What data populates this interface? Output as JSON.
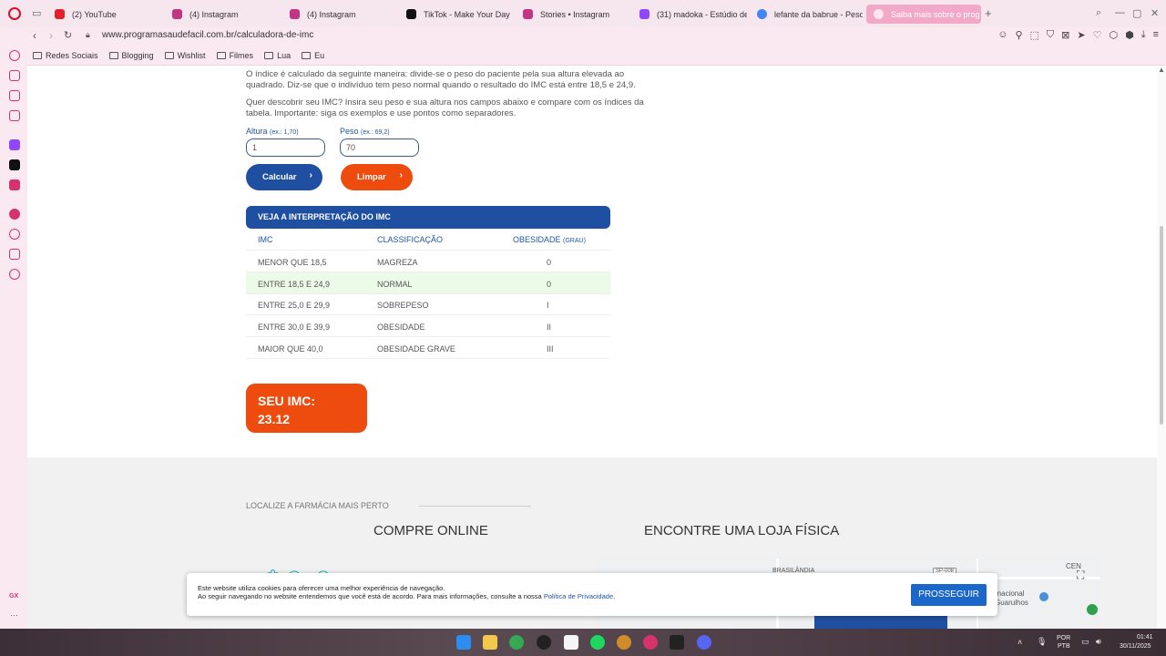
{
  "browser": {
    "tabs": [
      {
        "label": "(2) YouTube",
        "icon": "youtube-icon",
        "color": "#e0202b"
      },
      {
        "label": "(4) Instagram",
        "icon": "instagram-icon",
        "color": "#c13584"
      },
      {
        "label": "(4) Instagram",
        "icon": "instagram-icon",
        "color": "#c13584"
      },
      {
        "label": "TikTok - Make Your Day",
        "icon": "tiktok-icon",
        "color": "#111111"
      },
      {
        "label": "Stories • Instagram",
        "icon": "instagram-icon",
        "color": "#c13584"
      },
      {
        "label": "(31) madoka - Estúdio de",
        "icon": "twitch-icon",
        "color": "#9146ff"
      },
      {
        "label": "lefante da babrue - Pesq",
        "icon": "google-icon",
        "color": "#4285f4"
      },
      {
        "label": "Saiba mais sobre o prog",
        "icon": "page-icon",
        "color": "#ffffff"
      }
    ],
    "new_tab": "+",
    "url": "www.programasaudefacil.com.br/calculadora-de-imc",
    "bookmarks": [
      "Redes Sociais",
      "Blogging",
      "Wishlist",
      "Filmes",
      "Lua",
      "Eu"
    ],
    "sidebar_badge": "GX",
    "sidebar_more": "···"
  },
  "page": {
    "intro1": "O índice é calculado da seguinte maneira: divide-se o peso do paciente pela sua altura elevada ao quadrado. Diz-se que o indivíduo tem peso normal quando o resultado do IMC está entre 18,5 e 24,9.",
    "intro2": "Quer descobrir seu IMC? Insira seu peso e sua altura nos campos abaixo e compare com os índices da tabela. Importante: siga os exemplos e use pontos como separadores.",
    "height_label": "Altura",
    "height_hint": "(ex.: 1,70)",
    "height_value": "1",
    "weight_label": "Peso",
    "weight_hint": "(ex.: 69,2)",
    "weight_value": "70",
    "calc_button": "Calcular",
    "clear_button": "Limpar",
    "table_title": "VEJA A INTERPRETAÇÃO DO IMC",
    "table_headers": {
      "imc": "IMC",
      "class": "CLASSIFICAÇÃO",
      "obesity": "OBESIDADE",
      "obesity_unit": "(GRAU)"
    },
    "table_rows": [
      {
        "imc": "MENOR QUE 18,5",
        "class": "MAGREZA",
        "grade": "0"
      },
      {
        "imc": "ENTRE 18,5 E 24,9",
        "class": "NORMAL",
        "grade": "0"
      },
      {
        "imc": "ENTRE 25,0 E 29,9",
        "class": "SOBREPESO",
        "grade": "I"
      },
      {
        "imc": "ENTRE 30,0 E 39,9",
        "class": "OBESIDADE",
        "grade": "II"
      },
      {
        "imc": "MAIOR QUE 40,0",
        "class": "OBESIDADE GRAVE",
        "grade": "III"
      }
    ],
    "result_label": "SEU IMC:",
    "result_value": "23.12",
    "locate": "LOCALIZE A FARMÁCIA MAIS PERTO",
    "buy_online": "COMPRE ONLINE",
    "find_store": "ENCONTRE UMA LOJA FÍSICA",
    "map_labels": {
      "a": "BRASILÂNDIA",
      "b": "SP-008",
      "c": "CEN",
      "d": "rnacional",
      "e": "Guarulhos"
    }
  },
  "cookie": {
    "line1": "Este website utiliza cookies para oferecer uma melhor experiência de navegação.",
    "line2": "Ao seguir navegando no website entendemos que você está de acordo. Para mais informações, consulte a nossa",
    "link": "Política de Privacidade",
    "button": "PROSSEGUIR"
  },
  "taskbar": {
    "lang1": "POR",
    "lang2": "PTB",
    "time": "01:41",
    "date": "30/11/2025"
  },
  "colors": {
    "primary_blue": "#1f4fa0",
    "orange": "#ee4c0e",
    "highlight_row": "#ecfbe8"
  }
}
